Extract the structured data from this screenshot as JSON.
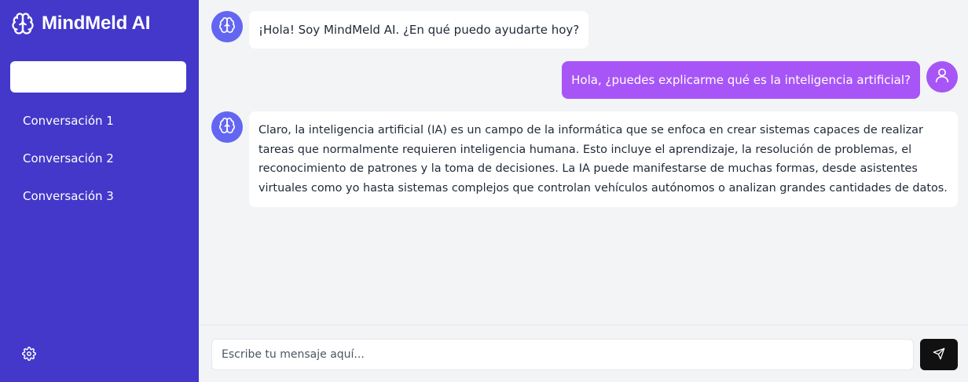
{
  "app": {
    "name": "MindMeld AI",
    "brand_icon": "brain-icon"
  },
  "sidebar": {
    "new_chat_label": "",
    "conversations": [
      {
        "label": "Conversación 1"
      },
      {
        "label": "Conversación 2"
      },
      {
        "label": "Conversación 3"
      }
    ],
    "settings_icon": "gear-icon"
  },
  "messages": [
    {
      "role": "assistant",
      "icon": "brain-icon",
      "text": "¡Hola! Soy MindMeld AI. ¿En qué puedo ayudarte hoy?"
    },
    {
      "role": "user",
      "icon": "user-icon",
      "text": "Hola, ¿puedes explicarme qué es la inteligencia artificial?"
    },
    {
      "role": "assistant",
      "icon": "brain-icon",
      "text": "Claro, la inteligencia artificial (IA) es un campo de la informática que se enfoca en crear sistemas capaces de realizar tareas que normalmente requieren inteligencia humana. Esto incluye el aprendizaje, la resolución de problemas, el reconocimiento de patrones y la toma de decisiones. La IA puede manifestarse de muchas formas, desde asistentes virtuales como yo hasta sistemas complejos que controlan vehículos autónomos o analizan grandes cantidades de datos."
    }
  ],
  "composer": {
    "placeholder": "Escribe tu mensaje aquí...",
    "value": "",
    "send_icon": "send-icon"
  },
  "colors": {
    "sidebar": "#4338ca",
    "assistant_avatar": "#6366f1",
    "user_accent": "#a855f7",
    "send_button": "#111111",
    "background": "#f3f4f6"
  }
}
